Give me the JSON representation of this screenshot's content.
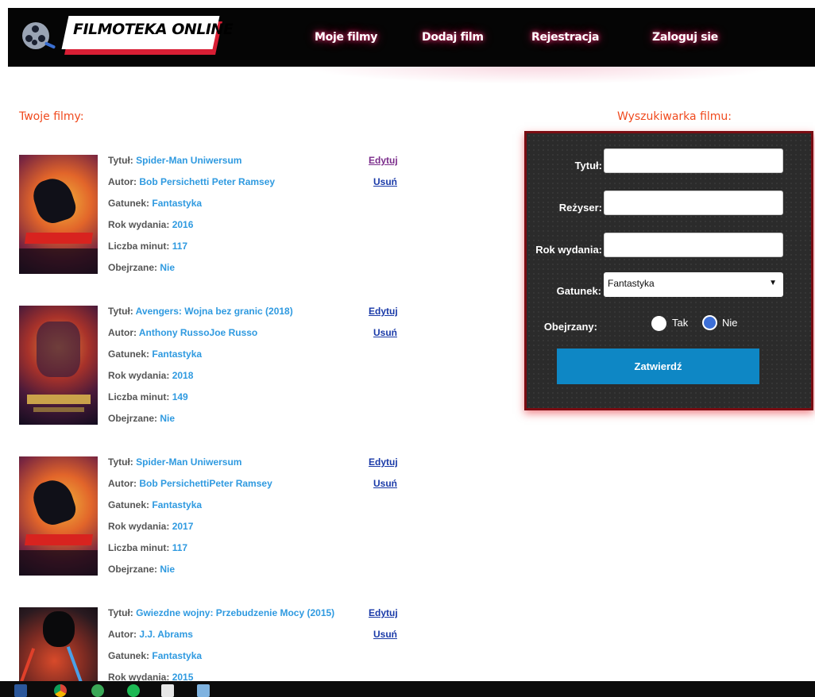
{
  "header": {
    "logo": "FILMOTEKA ONLINE",
    "nav": [
      "Moje filmy",
      "Dodaj film",
      "Rejestracja",
      "Zaloguj sie"
    ]
  },
  "list_title": "Twoje filmy:",
  "search_title": "Wyszukiwarka filmu:",
  "movie_labels": {
    "title": "Tytuł:",
    "author": "Autor:",
    "genre": "Gatunek:",
    "year": "Rok wydania:",
    "minutes": "Liczba minut:",
    "watched": "Obejrzane:",
    "edit": "Edytuj",
    "delete": "Usuń"
  },
  "movies": [
    {
      "title": "Spider-Man Uniwersum",
      "author": "Bob Persichetti Peter Ramsey",
      "genre": "Fantastyka",
      "year": "2016",
      "minutes": "117",
      "watched": "Nie"
    },
    {
      "title": "Avengers: Wojna bez granic (2018)",
      "author": "Anthony RussoJoe Russo",
      "genre": "Fantastyka",
      "year": "2018",
      "minutes": "149",
      "watched": "Nie"
    },
    {
      "title": "Spider-Man Uniwersum",
      "author": "Bob PersichettiPeter Ramsey",
      "genre": "Fantastyka",
      "year": "2017",
      "minutes": "117",
      "watched": "Nie"
    },
    {
      "title": "Gwiezdne wojny: Przebudzenie Mocy (2015)",
      "author": "J.J. Abrams",
      "genre": "Fantastyka",
      "year": "2015",
      "minutes": "",
      "watched": ""
    }
  ],
  "search": {
    "title_label": "Tytuł:",
    "director_label": "Reżyser:",
    "year_label": "Rok wydania:",
    "genre_label": "Gatunek:",
    "genre_selected": "Fantastyka",
    "watched_label": "Obejrzany:",
    "opt_yes": "Tak",
    "opt_no": "Nie",
    "submit": "Zatwierdź"
  },
  "colors": {
    "accent": "#f04a1e",
    "link_value": "#2f9ae0",
    "button": "#0e87c5",
    "panel_border": "#7a0c12",
    "edit_link": "#7b2d8b"
  }
}
